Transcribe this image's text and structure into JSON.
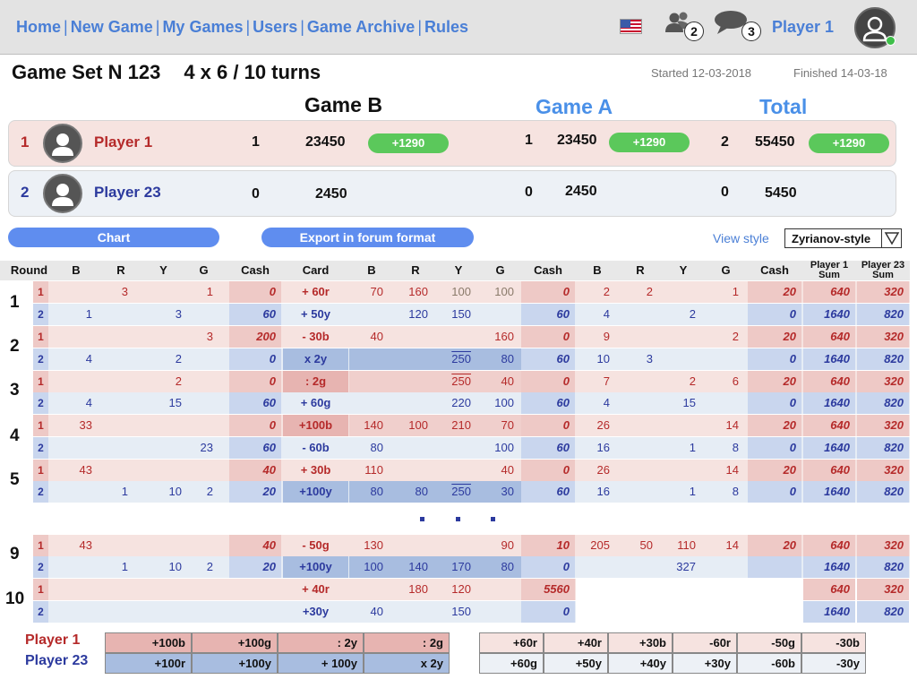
{
  "nav": {
    "links": [
      "Home",
      "New Game",
      "My Games",
      "Users",
      "Game Archive",
      "Rules"
    ],
    "sep": "|",
    "friends_count": "2",
    "messages_count": "3",
    "player_name": "Player 1"
  },
  "game": {
    "title": "Game Set N 123",
    "subtitle": "4 x 6 / 10 turns",
    "started": "Started 12-03-2018",
    "finished": "Finished 14-03-18",
    "columns": {
      "game_b": "Game B",
      "game_a": "Game A",
      "total": "Total"
    }
  },
  "players": [
    {
      "rank": "1",
      "name": "Player 1",
      "b_wins": "1",
      "b_score": "23450",
      "b_delta": "+1290",
      "a_wins": "1",
      "a_score": "23450",
      "a_delta": "+1290",
      "t_wins": "2",
      "t_score": "55450",
      "t_delta": "+1290"
    },
    {
      "rank": "2",
      "name": "Player 23",
      "b_wins": "0",
      "b_score": "2450",
      "a_wins": "0",
      "a_score": "2450",
      "t_wins": "0",
      "t_score": "5450"
    }
  ],
  "controls": {
    "chart": "Chart",
    "export": "Export in forum format",
    "view_style_label": "View style",
    "view_style_value": "Zyrianov-style"
  },
  "table": {
    "headers": {
      "round": "Round",
      "b1": "B",
      "r1": "R",
      "y1": "Y",
      "g1": "G",
      "cash1": "Cash",
      "card": "Card",
      "b2": "B",
      "r2": "R",
      "y2": "Y",
      "g2": "G",
      "cash2": "Cash",
      "b3": "B",
      "r3": "R",
      "y3": "Y",
      "g3": "G",
      "cash3": "Cash",
      "p1sum": "Player 1 Sum",
      "p23sum": "Player 23 Sum"
    },
    "rows": [
      {
        "round": "1",
        "p": "1",
        "b1": "",
        "r1": "3",
        "y1": "",
        "g1": "1",
        "cash1": "0",
        "card": "+ 60r",
        "b2": "70",
        "r2": "160",
        "y2": "100",
        "g2": "100",
        "cash2": "0",
        "b3": "2",
        "r3": "2",
        "y3": "",
        "g3": "1",
        "cash3": "20",
        "s1": "640",
        "s2": "320"
      },
      {
        "round": "",
        "p": "2",
        "b1": "1",
        "r1": "",
        "y1": "3",
        "g1": "",
        "cash1": "60",
        "card": "+ 50y",
        "b2": "",
        "r2": "120",
        "y2": "150",
        "g2": "",
        "cash2": "60",
        "b3": "4",
        "r3": "",
        "y3": "2",
        "g3": "",
        "cash3": "0",
        "s1": "1640",
        "s2": "820"
      },
      {
        "round": "2",
        "p": "1",
        "b1": "",
        "r1": "",
        "y1": "",
        "g1": "3",
        "cash1": "200",
        "card": "- 30b",
        "b2": "40",
        "r2": "",
        "y2": "",
        "g2": "160",
        "cash2": "0",
        "b3": "9",
        "r3": "",
        "y3": "",
        "g3": "2",
        "cash3": "20",
        "s1": "640",
        "s2": "320"
      },
      {
        "round": "",
        "p": "2",
        "b1": "4",
        "r1": "",
        "y1": "2",
        "g1": "",
        "cash1": "0",
        "card": "x 2y",
        "b2": "",
        "r2": "",
        "y2": "250",
        "g2": "80",
        "cash2": "60",
        "b3": "10",
        "r3": "3",
        "y3": "",
        "g3": "",
        "cash3": "0",
        "s1": "1640",
        "s2": "820"
      },
      {
        "round": "3",
        "p": "1",
        "b1": "",
        "r1": "",
        "y1": "2",
        "g1": "",
        "cash1": "0",
        "card": ": 2g",
        "b2": "",
        "r2": "",
        "y2": "250",
        "g2": "40",
        "cash2": "0",
        "b3": "7",
        "r3": "",
        "y3": "2",
        "g3": "6",
        "cash3": "20",
        "s1": "640",
        "s2": "320"
      },
      {
        "round": "",
        "p": "2",
        "b1": "4",
        "r1": "",
        "y1": "15",
        "g1": "",
        "cash1": "60",
        "card": "+ 60g",
        "b2": "",
        "r2": "",
        "y2": "220",
        "g2": "100",
        "cash2": "60",
        "b3": "4",
        "r3": "",
        "y3": "15",
        "g3": "",
        "cash3": "0",
        "s1": "1640",
        "s2": "820"
      },
      {
        "round": "4",
        "p": "1",
        "b1": "33",
        "r1": "",
        "y1": "",
        "g1": "",
        "cash1": "0",
        "card": "+100b",
        "b2": "140",
        "r2": "100",
        "y2": "210",
        "g2": "70",
        "cash2": "0",
        "b3": "26",
        "r3": "",
        "y3": "",
        "g3": "14",
        "cash3": "20",
        "s1": "640",
        "s2": "320"
      },
      {
        "round": "",
        "p": "2",
        "b1": "",
        "r1": "",
        "y1": "",
        "g1": "23",
        "cash1": "60",
        "card": "- 60b",
        "b2": "80",
        "r2": "",
        "y2": "",
        "g2": "100",
        "cash2": "60",
        "b3": "16",
        "r3": "",
        "y3": "1",
        "g3": "8",
        "cash3": "0",
        "s1": "1640",
        "s2": "820"
      },
      {
        "round": "5",
        "p": "1",
        "b1": "43",
        "r1": "",
        "y1": "",
        "g1": "",
        "cash1": "40",
        "card": "+ 30b",
        "b2": "110",
        "r2": "",
        "y2": "",
        "g2": "40",
        "cash2": "0",
        "b3": "26",
        "r3": "",
        "y3": "",
        "g3": "14",
        "cash3": "20",
        "s1": "640",
        "s2": "320"
      },
      {
        "round": "",
        "p": "2",
        "b1": "",
        "r1": "1",
        "y1": "10",
        "g1": "2",
        "cash1": "20",
        "card": "+100y",
        "b2": "80",
        "r2": "80",
        "y2": "250",
        "g2": "30",
        "cash2": "60",
        "b3": "16",
        "r3": "",
        "y3": "1",
        "g3": "8",
        "cash3": "0",
        "s1": "1640",
        "s2": "820"
      },
      {
        "round": "9",
        "p": "1",
        "b1": "43",
        "r1": "",
        "y1": "",
        "g1": "",
        "cash1": "40",
        "card": "- 50g",
        "b2": "130",
        "r2": "",
        "y2": "",
        "g2": "90",
        "cash2": "10",
        "b3": "205",
        "r3": "50",
        "y3": "110",
        "g3": "14",
        "cash3": "20",
        "s1": "640",
        "s2": "320"
      },
      {
        "round": "",
        "p": "2",
        "b1": "",
        "r1": "1",
        "y1": "10",
        "g1": "2",
        "cash1": "20",
        "card": "+100y",
        "b2": "100",
        "r2": "140",
        "y2": "170",
        "g2": "80",
        "cash2": "0",
        "b3": "",
        "r3": "",
        "y3": "327",
        "g3": "",
        "cash3": "",
        "s1": "1640",
        "s2": "820"
      },
      {
        "round": "10",
        "p": "1",
        "b1": "",
        "r1": "",
        "y1": "",
        "g1": "",
        "cash1": "",
        "card": "+ 40r",
        "b2": "",
        "r2": "180",
        "y2": "120",
        "g2": "",
        "cash2": "5560",
        "b3": "",
        "r3": "",
        "y3": "",
        "g3": "",
        "cash3": "",
        "s1": "640",
        "s2": "320"
      },
      {
        "round": "",
        "p": "2",
        "b1": "",
        "r1": "",
        "y1": "",
        "g1": "",
        "cash1": "",
        "card": "+30y",
        "b2": "40",
        "r2": "",
        "y2": "150",
        "g2": "",
        "cash2": "0",
        "b3": "",
        "r3": "",
        "y3": "",
        "g3": "",
        "cash3": "",
        "s1": "1640",
        "s2": "820"
      }
    ]
  },
  "legend": {
    "player1": "Player 1",
    "player23": "Player 23",
    "left_p1": [
      "+100b",
      "+100g",
      ": 2y",
      ": 2g"
    ],
    "left_p23": [
      "+100r",
      "+100y",
      "+ 100y",
      "x 2y"
    ],
    "right_p1": [
      "+60r",
      "+40r",
      "+30b",
      "-60r",
      "-50g",
      "-30b"
    ],
    "right_p23": [
      "+60g",
      "+50y",
      "+40y",
      "+30y",
      "-60b",
      "-30y"
    ]
  },
  "colors": {
    "link_blue": "#4a7fd6",
    "player1_red": "#b52a2a",
    "player23_blue": "#2c3a9e",
    "row_p1_bg": "#f6e3e0",
    "row_p2_bg": "#e6edf5",
    "cash_p1_bg": "#eec9c6",
    "cash_p2_bg": "#c9d6ee",
    "card_p1_bg": "#e7b4b1",
    "card_p2_bg": "#a8bde0",
    "green_badge": "#5bc85b"
  },
  "icons": [
    "us-flag-icon",
    "friends-icon",
    "messages-icon",
    "user-avatar-icon",
    "dropdown-arrow-icon"
  ]
}
